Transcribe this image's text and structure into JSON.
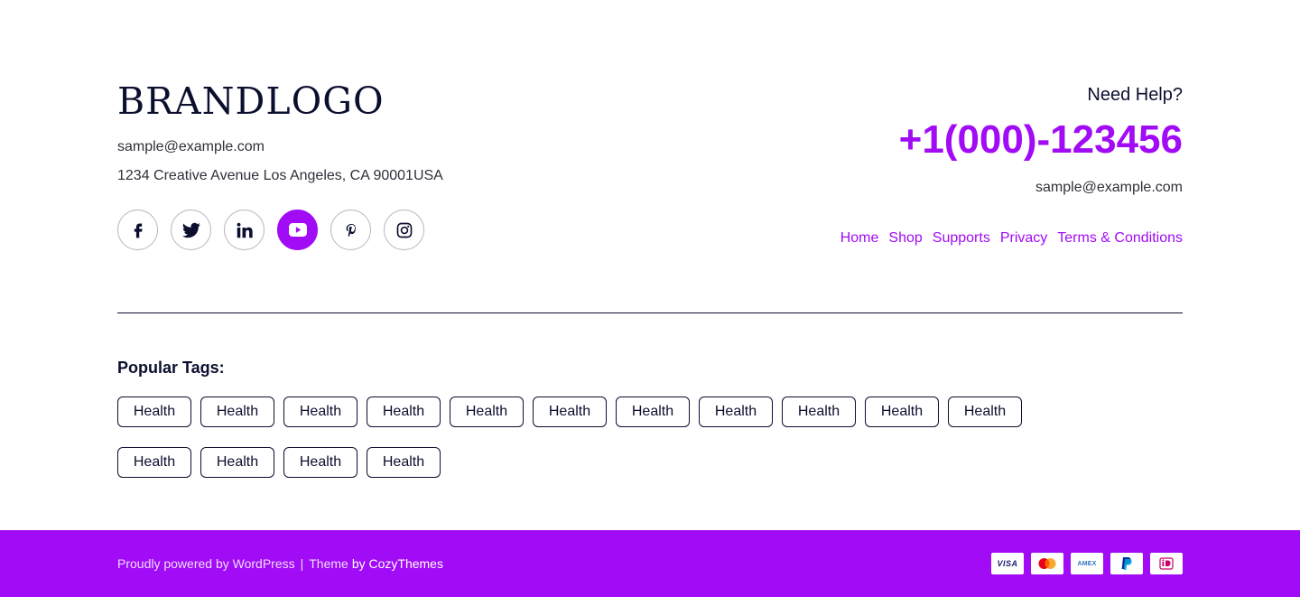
{
  "brand": {
    "logo_text": "BRANDLOGO"
  },
  "contact": {
    "email": "sample@example.com",
    "address": "1234 Creative Avenue Los Angeles, CA 90001USA"
  },
  "social": [
    {
      "name": "facebook",
      "icon": "facebook-icon",
      "active": false
    },
    {
      "name": "twitter",
      "icon": "twitter-icon",
      "active": false
    },
    {
      "name": "linkedin",
      "icon": "linkedin-icon",
      "active": false
    },
    {
      "name": "youtube",
      "icon": "youtube-icon",
      "active": true
    },
    {
      "name": "pinterest",
      "icon": "pinterest-icon",
      "active": false
    },
    {
      "name": "instagram",
      "icon": "instagram-icon",
      "active": false
    }
  ],
  "help": {
    "title": "Need Help?",
    "phone": "+1(000)-123456",
    "email": "sample@example.com"
  },
  "nav": {
    "items": [
      {
        "label": "Home"
      },
      {
        "label": "Shop"
      },
      {
        "label": "Supports"
      },
      {
        "label": "Privacy"
      },
      {
        "label": "Terms & Conditions"
      }
    ]
  },
  "tags": {
    "title": "Popular Tags:",
    "items": [
      "Health",
      "Health",
      "Health",
      "Health",
      "Health",
      "Health",
      "Health",
      "Health",
      "Health",
      "Health",
      "Health",
      "Health",
      "Health",
      "Health",
      "Health"
    ]
  },
  "bottom": {
    "powered_text": "Proudly powered by WordPress",
    "separator": "|",
    "theme_prefix": "Theme",
    "theme_by": "by CozyThemes",
    "payments": [
      {
        "name": "visa",
        "label": "VISA"
      },
      {
        "name": "mastercard",
        "label": ""
      },
      {
        "name": "amex",
        "label": "AMEX"
      },
      {
        "name": "paypal",
        "label": ""
      },
      {
        "name": "ideal",
        "label": ""
      }
    ]
  },
  "colors": {
    "accent": "#a10bf5",
    "text_dark": "#0b0f2e",
    "text_body": "#2f2f3a"
  }
}
